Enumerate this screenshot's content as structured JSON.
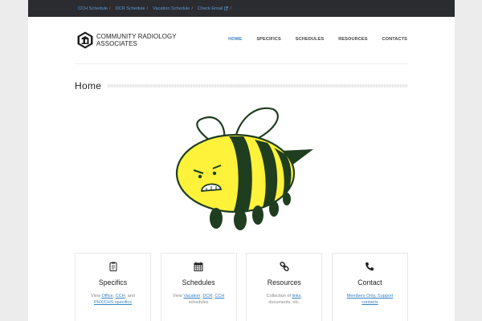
{
  "topbar": {
    "links": [
      {
        "label": "CCH Schedule"
      },
      {
        "label": "DCR Schedule"
      },
      {
        "label": "Vacation Schedule"
      },
      {
        "label": "Check Email"
      }
    ],
    "separator": "/"
  },
  "header": {
    "logo_line1": "COMMUNITY RADIOLOGY",
    "logo_line2": "ASSOCIATES",
    "nav": [
      {
        "label": "HOME",
        "active": true
      },
      {
        "label": "SPECIFICS"
      },
      {
        "label": "SCHEDULES"
      },
      {
        "label": "RESOURCES"
      },
      {
        "label": "CONTACTS"
      }
    ]
  },
  "main": {
    "title": "Home",
    "illustration_icon": "bee-illustration"
  },
  "cards": [
    {
      "icon": "clipboard-icon",
      "title": "Specifics",
      "desc_prefix": "View ",
      "links": [
        "Office",
        "CCH"
      ],
      "desc_mid": ", and",
      "desc_link3": "PHX/CHS specifics"
    },
    {
      "icon": "calendar-icon",
      "title": "Schedules",
      "desc_prefix": "View ",
      "links": [
        "Vacation",
        "DCR",
        "CCH"
      ],
      "desc_suffix": "schedules"
    },
    {
      "icon": "link-icon",
      "title": "Resources",
      "desc_prefix": "Collection of ",
      "link": "links",
      "desc_suffix": "documents, etc."
    },
    {
      "icon": "phone-icon",
      "title": "Contact",
      "line1": "Members Only, Support",
      "line2": "contacts"
    }
  ],
  "colors": {
    "topbar_bg": "#2b2c30",
    "link_blue": "#3a82c4",
    "bee_yellow": "#fff23a",
    "bee_dark": "#1f3d1f"
  }
}
